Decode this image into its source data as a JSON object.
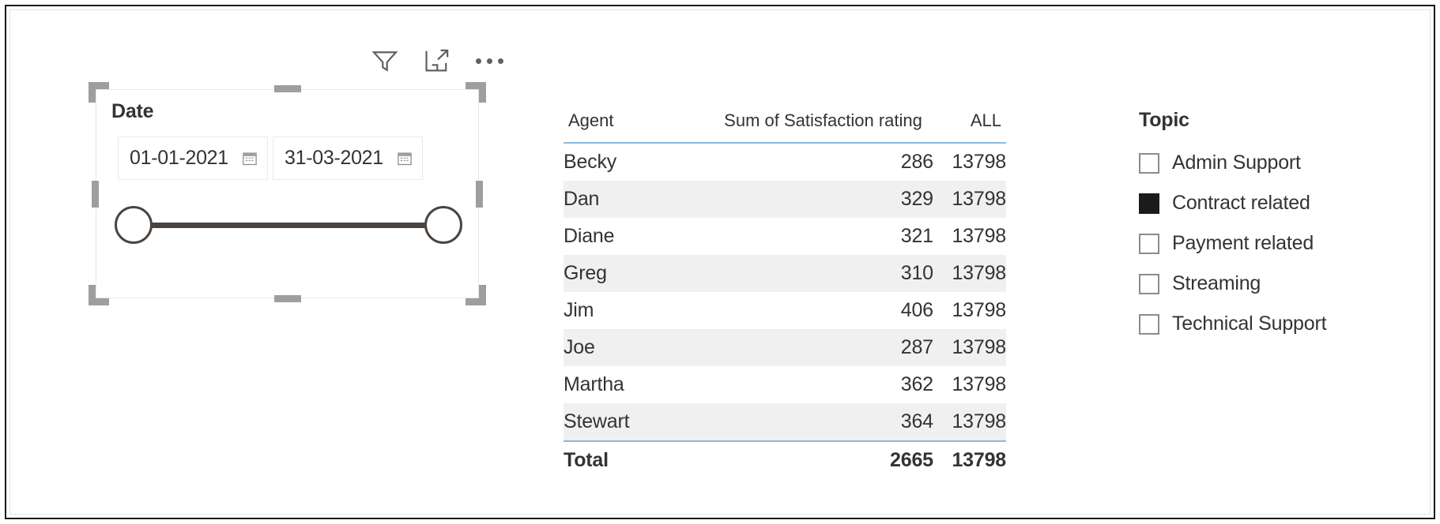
{
  "toolbar": {
    "filter_icon": "filter-funnel-icon",
    "focus_icon": "focus-mode-icon",
    "more_icon": "more-options-ellipsis-icon"
  },
  "date_slicer": {
    "title": "Date",
    "start_date": "01-01-2021",
    "end_date": "31-03-2021",
    "calendar_icon": "calendar-icon",
    "selected": true
  },
  "matrix": {
    "columns": [
      "Agent",
      "Sum of Satisfaction rating",
      "ALL"
    ],
    "rows": [
      {
        "agent": "Becky",
        "sum": "286",
        "all": "13798"
      },
      {
        "agent": "Dan",
        "sum": "329",
        "all": "13798"
      },
      {
        "agent": "Diane",
        "sum": "321",
        "all": "13798"
      },
      {
        "agent": "Greg",
        "sum": "310",
        "all": "13798"
      },
      {
        "agent": "Jim",
        "sum": "406",
        "all": "13798"
      },
      {
        "agent": "Joe",
        "sum": "287",
        "all": "13798"
      },
      {
        "agent": "Martha",
        "sum": "362",
        "all": "13798"
      },
      {
        "agent": "Stewart",
        "sum": "364",
        "all": "13798"
      }
    ],
    "total": {
      "label": "Total",
      "sum": "2665",
      "all": "13798"
    }
  },
  "topic_slicer": {
    "title": "Topic",
    "items": [
      {
        "label": "Admin Support",
        "checked": false
      },
      {
        "label": "Contract related",
        "checked": true
      },
      {
        "label": "Payment related",
        "checked": false
      },
      {
        "label": "Streaming",
        "checked": false
      },
      {
        "label": "Technical Support",
        "checked": false
      }
    ]
  },
  "colors": {
    "header_rule": "#8ab9e0",
    "alt_row": "#f0f0f0",
    "checked_box": "#1b1b1b",
    "handle": "#9e9e9e",
    "slider": "#4a4440"
  }
}
